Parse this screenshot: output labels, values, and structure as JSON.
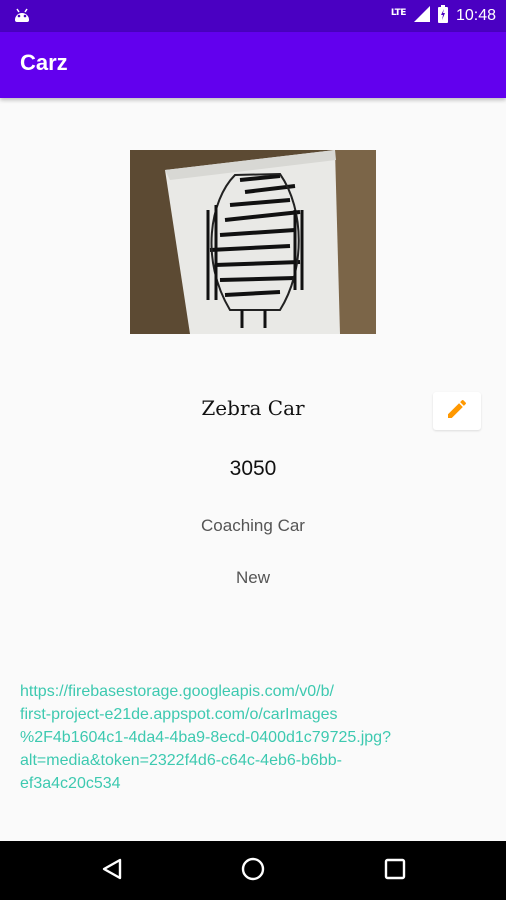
{
  "status_bar": {
    "time": "10:48",
    "network": "LTE",
    "icons": [
      "android-icon",
      "signal-icon",
      "battery-icon"
    ]
  },
  "app_bar": {
    "title": "Carz",
    "color": "#6200ee"
  },
  "car": {
    "image": "zebra-drawing-photo",
    "name": "Zebra Car",
    "price": "3050",
    "type": "Coaching Car",
    "condition": "New",
    "image_url_lines": [
      "https://firebasestorage.googleapis.com/v0/b/",
      "first-project-e21de.appspot.com/o/carImages",
      "%2F4b1604c1-4da4-4ba9-8ecd-0400d1c79725.jpg?",
      "alt=media&token=2322f4d6-c64c-4eb6-b6bb-",
      "ef3a4c20c534"
    ]
  },
  "edit_button": {
    "icon": "pencil-icon",
    "color": "#ff9800"
  },
  "nav_bar": {
    "buttons": [
      "back-icon",
      "home-icon",
      "recents-icon"
    ]
  }
}
